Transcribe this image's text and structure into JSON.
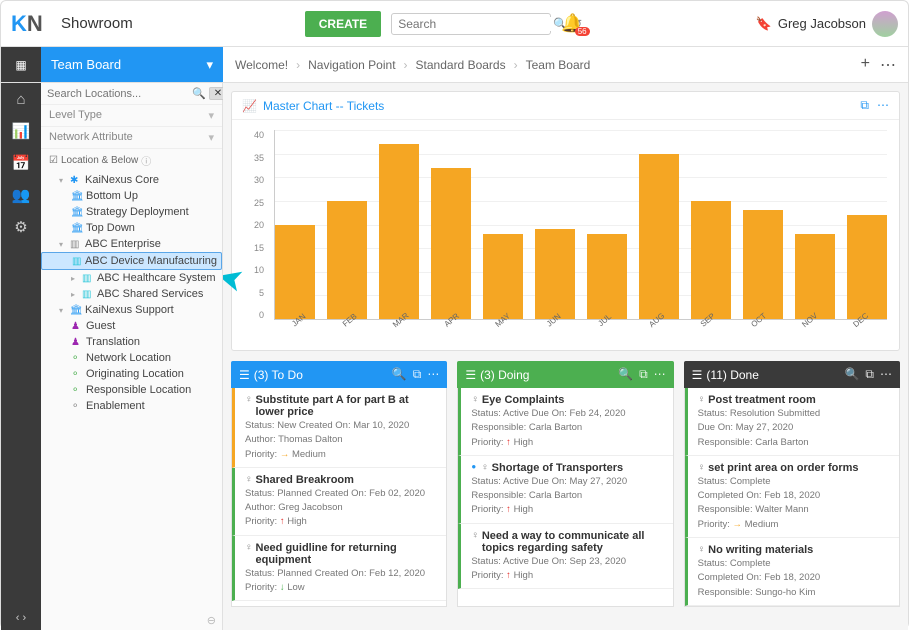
{
  "header": {
    "room": "Showroom",
    "create": "CREATE",
    "search_ph": "Search",
    "notif_count": "56",
    "user": "Greg Jacobson"
  },
  "subhdr": {
    "title": "Team Board",
    "crumbs": [
      "Welcome!",
      "Navigation Point",
      "Standard Boards",
      "Team Board"
    ]
  },
  "sidebar": {
    "search_ph": "Search Locations...",
    "level": "Level Type",
    "netattr": "Network Attribute",
    "locbelow": "Location & Below",
    "tree": {
      "core": "KaiNexus Core",
      "bottomup": "Bottom Up",
      "strategy": "Strategy Deployment",
      "topdown": "Top Down",
      "abc": "ABC Enterprise",
      "abcdev": "ABC Device Manufacturing",
      "abchc": "ABC Healthcare System",
      "abcss": "ABC Shared Services",
      "support": "KaiNexus Support",
      "guest": "Guest",
      "trans": "Translation",
      "netloc": "Network Location",
      "origloc": "Originating Location",
      "resploc": "Responsible Location",
      "enable": "Enablement"
    }
  },
  "chart_title": "Master Chart -- Tickets",
  "chart_data": {
    "type": "bar",
    "categories": [
      "JAN",
      "FEB",
      "MAR",
      "APR",
      "MAY",
      "JUN",
      "JUL",
      "AUG",
      "SEP",
      "OCT",
      "NOV",
      "DEC"
    ],
    "values": [
      20,
      25,
      37,
      32,
      18,
      19,
      18,
      35,
      25,
      23,
      18,
      22
    ],
    "ylabel": "",
    "ylim": [
      0,
      40
    ],
    "yticks": [
      40,
      35,
      30,
      25,
      20,
      15,
      10,
      5,
      0
    ]
  },
  "boards": {
    "todo": {
      "title": "(3) To Do",
      "cards": [
        {
          "title": "Substitute part A for part B at lower price",
          "row1": "Status: New   Created On: Mar 10, 2020",
          "row2": "Author: Thomas Dalton",
          "prio": "Medium",
          "pclass": "prio-med",
          "arrow": "→",
          "bl": "bl-yellow"
        },
        {
          "title": "Shared Breakroom",
          "row1": "Status: Planned   Created On: Feb 02, 2020",
          "row2": "Author: Greg Jacobson",
          "prio": "High",
          "pclass": "prio-high",
          "arrow": "↑",
          "bl": "bl-green"
        },
        {
          "title": "Need guidline for returning equipment",
          "row1": "Status: Planned   Created On: Feb 12, 2020",
          "row2": "",
          "prio": "Low",
          "pclass": "prio-low",
          "arrow": "↓",
          "bl": "bl-green"
        }
      ]
    },
    "doing": {
      "title": "(3) Doing",
      "cards": [
        {
          "title": "Eye Complaints",
          "row1": "Status: Active   Due On: Feb 24, 2020",
          "row2": "Responsible: Carla Barton",
          "prio": "High",
          "pclass": "prio-high",
          "arrow": "↑",
          "bl": "bl-green",
          "dot": false
        },
        {
          "title": "Shortage of Transporters",
          "row1": "Status: Active   Due On: May 27, 2020",
          "row2": "Responsible: Carla Barton",
          "prio": "High",
          "pclass": "prio-high",
          "arrow": "↑",
          "bl": "bl-green",
          "dot": true
        },
        {
          "title": "Need a way to communicate all topics regarding safety",
          "row1": "Status: Active   Due On: Sep 23, 2020",
          "row2": "",
          "prio": "High",
          "pclass": "prio-high",
          "arrow": "↑",
          "bl": "bl-green",
          "dot": false
        }
      ]
    },
    "done": {
      "title": "(11) Done",
      "cards": [
        {
          "title": "Post treatment room",
          "row1": "Status: Resolution Submitted",
          "row2": "Due On: May 27, 2020",
          "row3": "Responsible: Carla Barton",
          "prio": "",
          "bl": "bl-green"
        },
        {
          "title": "set print area on order forms",
          "row1": "Status: Complete",
          "row2": "Completed On: Feb 18, 2020",
          "row3": "Responsible: Walter Mann",
          "prio": "Medium",
          "pclass": "prio-med",
          "arrow": "→",
          "bl": "bl-green"
        },
        {
          "title": "No writing materials",
          "row1": "Status: Complete",
          "row2": "Completed On: Feb 18, 2020",
          "row3": "Responsible: Sungo-ho Kim",
          "prio": "",
          "bl": "bl-green"
        }
      ]
    }
  }
}
